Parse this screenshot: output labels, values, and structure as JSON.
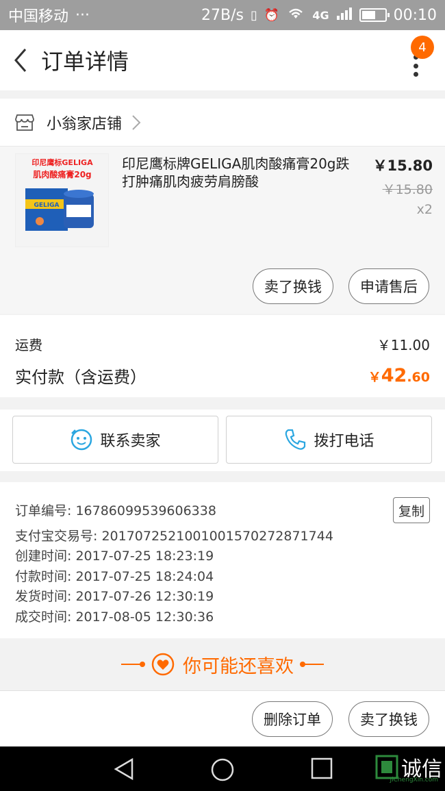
{
  "status_bar": {
    "carrier": "中国移动",
    "dots": "···",
    "speed": "27B/s",
    "network": "4G",
    "time": "00:10",
    "battery_level": 0.6
  },
  "header": {
    "title": "订单详情",
    "badge_count": "4"
  },
  "shop": {
    "name": "小翁家店铺"
  },
  "item": {
    "image_text_line1": "印尼鹰标GELIGA",
    "image_text_line2": "肌肉酸痛膏20g",
    "image_jar_label": "GELIGA",
    "title": "印尼鹰标牌GELIGA肌肉酸痛膏20g跌打肿痛肌肉疲劳肩膀酸",
    "price": "￥15.80",
    "original_price": "￥15.80",
    "quantity": "x2",
    "sell_button": "卖了换钱",
    "after_sale_button": "申请售后"
  },
  "fees": {
    "shipping_label": "运费",
    "shipping_value": "￥11.00",
    "total_label": "实付款（含运费）",
    "total_currency": "￥",
    "total_int": "42",
    "total_dec": ".60"
  },
  "contact": {
    "seller_label": "联系卖家",
    "phone_label": "拨打电话"
  },
  "order_info": {
    "order_no": "订单编号: 16786099539606338",
    "alipay_no": "支付宝交易号: 2017072521001001570272871744",
    "created": "创建时间: 2017-07-25 18:23:19",
    "paid": "付款时间: 2017-07-25 18:24:04",
    "shipped": "发货时间: 2017-07-26 12:30:19",
    "completed": "成交时间: 2017-08-05 12:30:36",
    "copy_label": "复制"
  },
  "recommend": {
    "text": "你可能还喜欢"
  },
  "bottom_actions": {
    "delete_label": "删除订单",
    "sell_label": "卖了换钱"
  },
  "watermark": {
    "text": "诚信",
    "sub": "JiChengXin.com"
  },
  "colors": {
    "accent": "#ff6a00",
    "status_bar": "#9e9e9e",
    "contact_icon": "#2aa6e0"
  }
}
